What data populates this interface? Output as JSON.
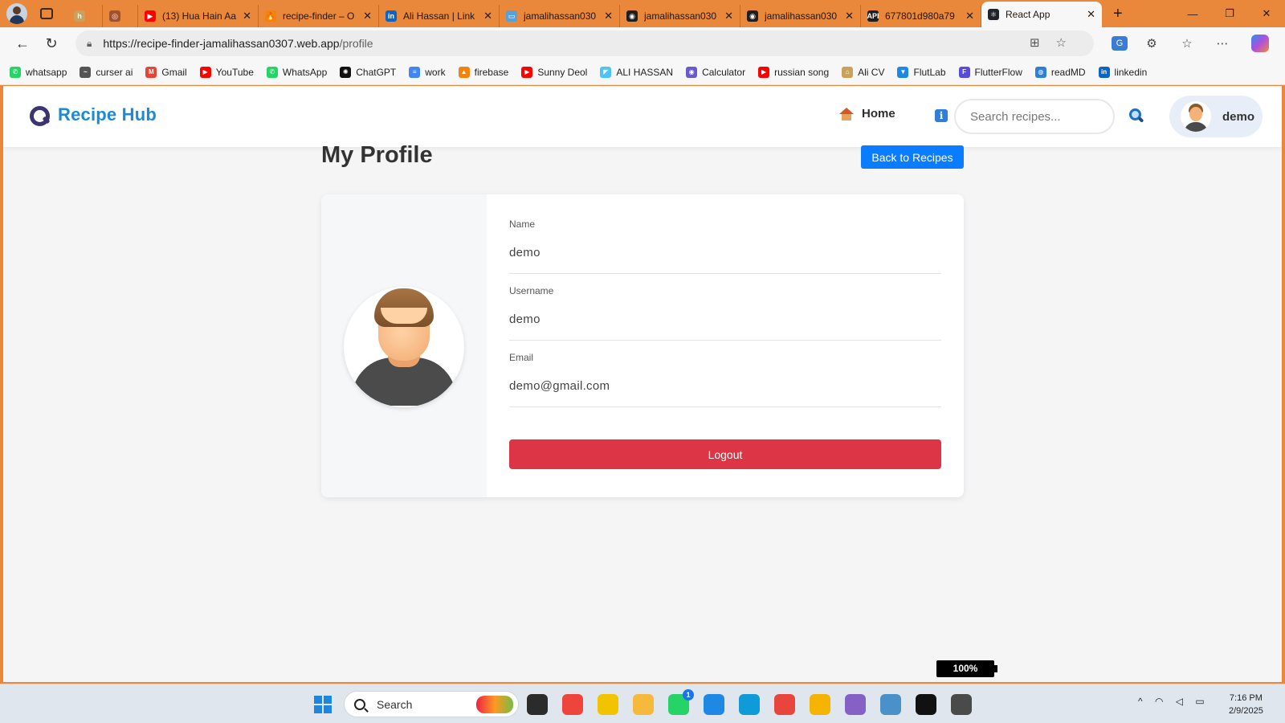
{
  "browser": {
    "tabs": [
      {
        "title": "",
        "favicon_color": "#c9a15c",
        "favicon_text": "h",
        "closable": false
      },
      {
        "title": "",
        "favicon_color": "#a0522d",
        "favicon_text": "◎",
        "closable": false
      },
      {
        "title": "(13) Hua Hain Aa",
        "favicon_color": "#ff0000",
        "favicon_text": "▶",
        "closable": true
      },
      {
        "title": "recipe-finder – O",
        "favicon_color": "#f5820d",
        "favicon_text": "🔥",
        "closable": true
      },
      {
        "title": "Ali Hassan | Link",
        "favicon_color": "#0a66c2",
        "favicon_text": "in",
        "closable": true
      },
      {
        "title": "jamalihassan030",
        "favicon_color": "#5aa0d8",
        "favicon_text": "▭",
        "closable": true
      },
      {
        "title": "jamalihassan030",
        "favicon_color": "#1f1f1f",
        "favicon_text": "◉",
        "closable": true
      },
      {
        "title": "jamalihassan030",
        "favicon_color": "#1f1f1f",
        "favicon_text": "◉",
        "closable": true
      },
      {
        "title": "677801d980a79",
        "favicon_color": "#1f1f1f",
        "favicon_text": "API",
        "closable": true
      },
      {
        "title": "React App",
        "favicon_color": "#20232a",
        "favicon_text": "⚛",
        "closable": true,
        "active": true
      }
    ],
    "close_glyph": "✕",
    "new_tab_glyph": "+",
    "window_controls": [
      "—",
      "❐",
      "✕"
    ],
    "url_host": "https://recipe-finder-jamalihassan0307.web.app",
    "url_path": "/profile",
    "bookmarks": [
      {
        "label": "whatsapp",
        "color": "#25d366",
        "glyph": "✆"
      },
      {
        "label": "curser ai",
        "color": "#555555",
        "glyph": "~"
      },
      {
        "label": "Gmail",
        "color": "#ea4335",
        "glyph": "M"
      },
      {
        "label": "YouTube",
        "color": "#ff0000",
        "glyph": "▶"
      },
      {
        "label": "WhatsApp",
        "color": "#25d366",
        "glyph": "✆"
      },
      {
        "label": "ChatGPT",
        "color": "#111111",
        "glyph": "✺"
      },
      {
        "label": "work",
        "color": "#4285f4",
        "glyph": "≡"
      },
      {
        "label": "firebase",
        "color": "#f5820d",
        "glyph": "▲"
      },
      {
        "label": "Sunny Deol",
        "color": "#ff0000",
        "glyph": "▶"
      },
      {
        "label": "ALI HASSAN",
        "color": "#4fc3f7",
        "glyph": "◤"
      },
      {
        "label": "Calculator",
        "color": "#6a5acd",
        "glyph": "◉"
      },
      {
        "label": "russian song",
        "color": "#ff0000",
        "glyph": "▶"
      },
      {
        "label": "Ali CV",
        "color": "#c9a15c",
        "glyph": "⌂"
      },
      {
        "label": "FlutLab",
        "color": "#1e88e5",
        "glyph": "▼"
      },
      {
        "label": "FlutterFlow",
        "color": "#5b4bdb",
        "glyph": "F"
      },
      {
        "label": "readMD",
        "color": "#2f7fd8",
        "glyph": "◍"
      },
      {
        "label": "linkedin",
        "color": "#0a66c2",
        "glyph": "in"
      }
    ]
  },
  "app": {
    "brand_name": "Recipe Hub",
    "nav_home": "Home",
    "search_placeholder": "Search recipes...",
    "user_name": "demo",
    "info_glyph": "i"
  },
  "profile": {
    "title": "My Profile",
    "back_button": "Back to Recipes",
    "fields": [
      {
        "label": "Name",
        "value": "demo"
      },
      {
        "label": "Username",
        "value": "demo"
      },
      {
        "label": "Email",
        "value": "demo@gmail.com"
      }
    ],
    "logout_button": "Logout"
  },
  "zoom_level": "100%",
  "taskbar": {
    "search_label": "Search",
    "time": "7:16 PM",
    "date": "2/9/2025",
    "notification_badge": "1",
    "apps": [
      {
        "name": "task-view",
        "color": "#2b2b2b"
      },
      {
        "name": "anydesk",
        "color": "#ef443b"
      },
      {
        "name": "chat-app",
        "color": "#f2c400"
      },
      {
        "name": "file-explorer",
        "color": "#f6b93b"
      },
      {
        "name": "whatsapp",
        "color": "#25d366"
      },
      {
        "name": "vscode",
        "color": "#1e88e5"
      },
      {
        "name": "edge",
        "color": "#0f9bd7"
      },
      {
        "name": "chrome",
        "color": "#e8453c"
      },
      {
        "name": "chrome-dev",
        "color": "#f4b400"
      },
      {
        "name": "visual-studio",
        "color": "#8661c5"
      },
      {
        "name": "resource-monitor",
        "color": "#4a90c9"
      },
      {
        "name": "capcut",
        "color": "#111111"
      },
      {
        "name": "clock-app",
        "color": "#4a4a4a"
      }
    ]
  }
}
